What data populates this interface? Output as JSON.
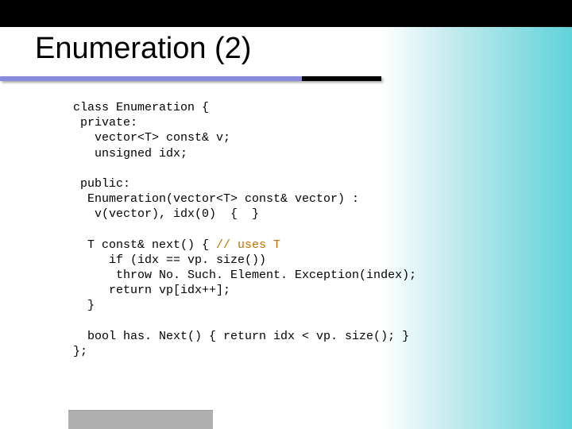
{
  "slide": {
    "title": "Enumeration (2)"
  },
  "code": {
    "l01": "class Enumeration {",
    "l02": " private:",
    "l03": "   vector<T> const& v;",
    "l04": "   unsigned idx;",
    "l05": "",
    "l06": " public:",
    "l07": "  Enumeration(vector<T> const& vector) :",
    "l08": "   v(vector), idx(0)  {  }",
    "l09": "",
    "l10a": "  T const& next() { ",
    "l10b": "// uses T",
    "l11": "     if (idx == vp. size())",
    "l12": "      throw No. Such. Element. Exception(index);",
    "l13": "     return vp[idx++];",
    "l14": "  }",
    "l15": "",
    "l16": "  bool has. Next() { return idx < vp. size(); }",
    "l17": "};"
  }
}
